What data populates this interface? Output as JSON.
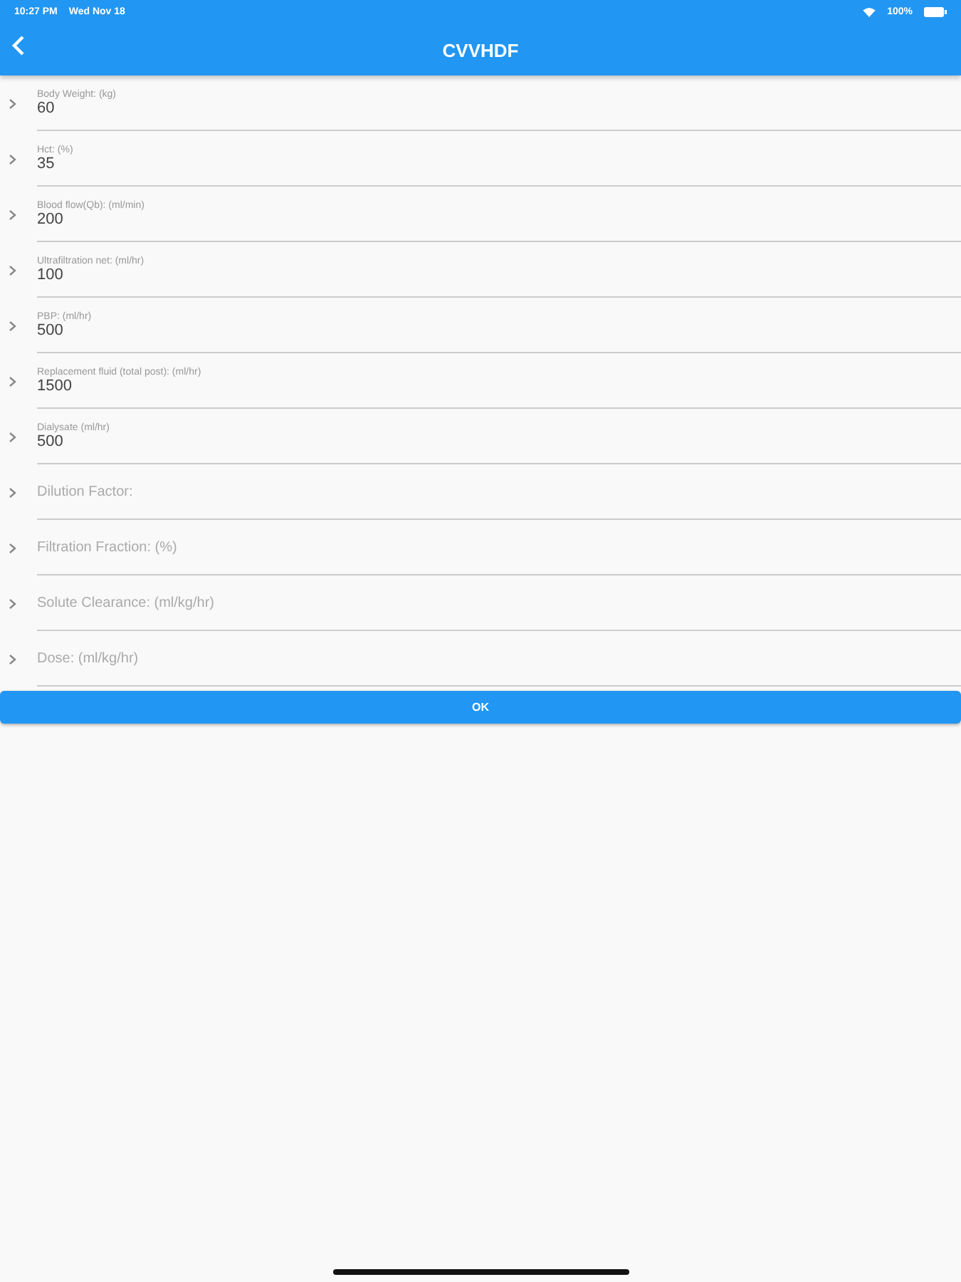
{
  "status_bar": {
    "time": "10:27 PM",
    "date": "Wed Nov 18",
    "battery": "100%"
  },
  "nav": {
    "title": "CVVHDF"
  },
  "fields": [
    {
      "kind": "input",
      "label": "Body Weight: (kg)",
      "value": "60"
    },
    {
      "kind": "input",
      "label": "Hct: (%)",
      "value": "35"
    },
    {
      "kind": "input",
      "label": "Blood flow(Qb): (ml/min)",
      "value": "200"
    },
    {
      "kind": "input",
      "label": "Ultrafiltration net: (ml/hr)",
      "value": "100"
    },
    {
      "kind": "input",
      "label": "PBP: (ml/hr)",
      "value": "500"
    },
    {
      "kind": "input",
      "label": "Replacement fluid (total post): (ml/hr)",
      "value": "1500"
    },
    {
      "kind": "input",
      "label": "Dialysate (ml/hr)",
      "value": "500"
    },
    {
      "kind": "result",
      "placeholder": "Dilution Factor:"
    },
    {
      "kind": "result",
      "placeholder": "Filtration Fraction: (%)"
    },
    {
      "kind": "result",
      "placeholder": "Solute Clearance: (ml/kg/hr)"
    },
    {
      "kind": "result",
      "placeholder": "Dose: (ml/kg/hr)"
    }
  ],
  "button": "OK"
}
